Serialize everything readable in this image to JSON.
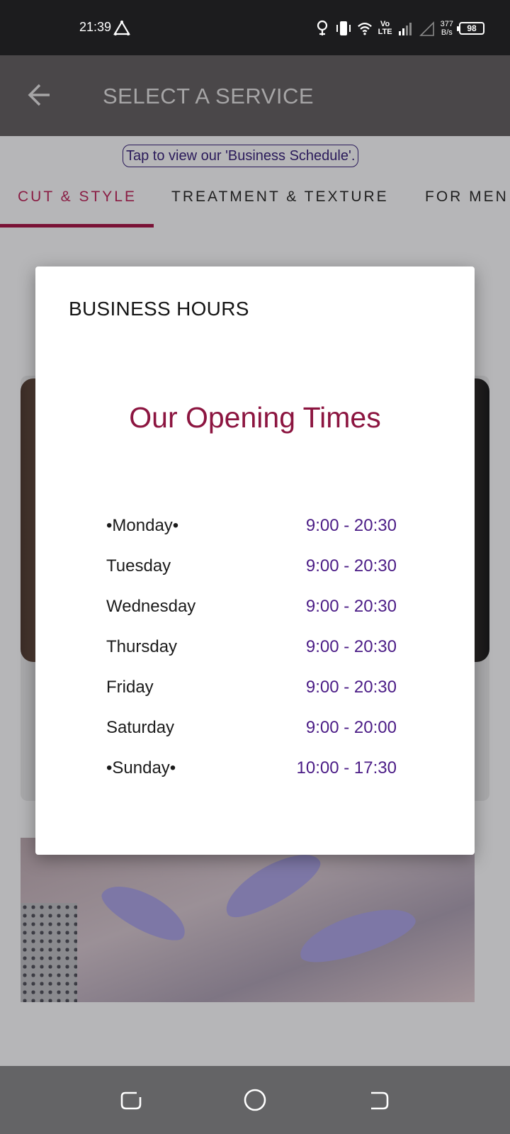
{
  "status_bar": {
    "time": "21:39",
    "volte_top": "Vo",
    "volte_bottom": "LTE",
    "net_speed_value": "377",
    "net_speed_unit": "B/s",
    "battery": "98"
  },
  "app_bar": {
    "title": "SELECT A SERVICE"
  },
  "schedule_link": "Tap to view our 'Business Schedule'.",
  "tabs": [
    {
      "label": "CUT & STYLE",
      "active": true
    },
    {
      "label": "TREATMENT & TEXTURE",
      "active": false
    },
    {
      "label": "FOR MEN",
      "active": false
    }
  ],
  "dialog": {
    "title": "BUSINESS HOURS",
    "heading": "Our Opening Times",
    "hours": [
      {
        "day": "•Monday•",
        "time": "9:00 - 20:30"
      },
      {
        "day": "Tuesday",
        "time": "9:00 - 20:30"
      },
      {
        "day": "Wednesday",
        "time": "9:00 - 20:30"
      },
      {
        "day": "Thursday",
        "time": "9:00 - 20:30"
      },
      {
        "day": "Friday",
        "time": "9:00 - 20:30"
      },
      {
        "day": "Saturday",
        "time": "9:00 - 20:00"
      },
      {
        "day": "•Sunday•",
        "time": "10:00 - 17:30"
      }
    ]
  },
  "colors": {
    "accent": "#8c1540",
    "time_text": "#4b1c86",
    "app_bar": "#4a4749"
  }
}
